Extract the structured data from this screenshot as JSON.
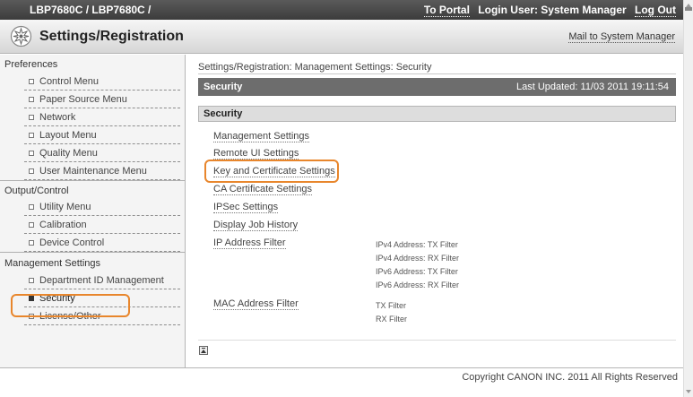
{
  "topbar": {
    "device": "LBP7680C / LBP7680C /",
    "to_portal": "To Portal",
    "login_user": "Login User: System Manager",
    "log_out": "Log Out"
  },
  "titlebar": {
    "title": "Settings/Registration",
    "icon": "settings-gear-icon",
    "mail": "Mail to System Manager"
  },
  "sidebar": {
    "preferences": {
      "heading": "Preferences",
      "items": [
        {
          "label": "Control Menu"
        },
        {
          "label": "Paper Source Menu"
        },
        {
          "label": "Network"
        },
        {
          "label": "Layout Menu"
        },
        {
          "label": "Quality Menu"
        },
        {
          "label": "User Maintenance Menu"
        }
      ]
    },
    "output": {
      "heading": "Output/Control",
      "items": [
        {
          "label": "Utility Menu"
        },
        {
          "label": "Calibration"
        },
        {
          "label": "Device Control"
        }
      ]
    },
    "management": {
      "heading": "Management Settings",
      "items": [
        {
          "label": "Department ID Management"
        },
        {
          "label": "Security"
        },
        {
          "label": "License/Other"
        }
      ]
    },
    "active_item": "Security"
  },
  "main": {
    "breadcrumb": "Settings/Registration: Management Settings: Security",
    "section_title": "Security",
    "last_updated": "Last Updated: 11/03 2011 19:11:54",
    "sub_title": "Security",
    "links": [
      {
        "label": "Management Settings"
      },
      {
        "label": "Remote UI Settings"
      },
      {
        "label": "Key and Certificate Settings"
      },
      {
        "label": "CA Certificate Settings"
      },
      {
        "label": "IPSec Settings"
      },
      {
        "label": "Display Job History"
      },
      {
        "label": "IP Address Filter"
      },
      {
        "label": "MAC Address Filter"
      }
    ],
    "ip_filters": [
      "IPv4 Address: TX Filter",
      "IPv4 Address: RX Filter",
      "IPv6 Address: TX Filter",
      "IPv6 Address: RX Filter"
    ],
    "mac_filters": [
      "TX Filter",
      "RX Filter"
    ],
    "top_icon": "back-to-top-icon"
  },
  "footer": {
    "copyright": "Copyright CANON INC. 2011 All Rights Reserved"
  },
  "colors": {
    "highlight": "#e8862c",
    "section_bar": "#6d6d6d",
    "top_bar": "#4a4a4a"
  }
}
